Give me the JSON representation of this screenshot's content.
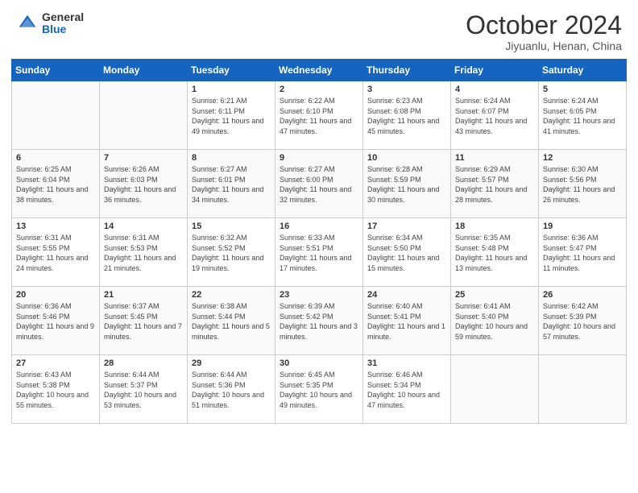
{
  "header": {
    "logo_general": "General",
    "logo_blue": "Blue",
    "month_title": "October 2024",
    "location": "Jiyuanlu, Henan, China"
  },
  "days_of_week": [
    "Sunday",
    "Monday",
    "Tuesday",
    "Wednesday",
    "Thursday",
    "Friday",
    "Saturday"
  ],
  "weeks": [
    [
      {
        "day": "",
        "sunrise": "",
        "sunset": "",
        "daylight": ""
      },
      {
        "day": "",
        "sunrise": "",
        "sunset": "",
        "daylight": ""
      },
      {
        "day": "1",
        "sunrise": "Sunrise: 6:21 AM",
        "sunset": "Sunset: 6:11 PM",
        "daylight": "Daylight: 11 hours and 49 minutes."
      },
      {
        "day": "2",
        "sunrise": "Sunrise: 6:22 AM",
        "sunset": "Sunset: 6:10 PM",
        "daylight": "Daylight: 11 hours and 47 minutes."
      },
      {
        "day": "3",
        "sunrise": "Sunrise: 6:23 AM",
        "sunset": "Sunset: 6:08 PM",
        "daylight": "Daylight: 11 hours and 45 minutes."
      },
      {
        "day": "4",
        "sunrise": "Sunrise: 6:24 AM",
        "sunset": "Sunset: 6:07 PM",
        "daylight": "Daylight: 11 hours and 43 minutes."
      },
      {
        "day": "5",
        "sunrise": "Sunrise: 6:24 AM",
        "sunset": "Sunset: 6:05 PM",
        "daylight": "Daylight: 11 hours and 41 minutes."
      }
    ],
    [
      {
        "day": "6",
        "sunrise": "Sunrise: 6:25 AM",
        "sunset": "Sunset: 6:04 PM",
        "daylight": "Daylight: 11 hours and 38 minutes."
      },
      {
        "day": "7",
        "sunrise": "Sunrise: 6:26 AM",
        "sunset": "Sunset: 6:03 PM",
        "daylight": "Daylight: 11 hours and 36 minutes."
      },
      {
        "day": "8",
        "sunrise": "Sunrise: 6:27 AM",
        "sunset": "Sunset: 6:01 PM",
        "daylight": "Daylight: 11 hours and 34 minutes."
      },
      {
        "day": "9",
        "sunrise": "Sunrise: 6:27 AM",
        "sunset": "Sunset: 6:00 PM",
        "daylight": "Daylight: 11 hours and 32 minutes."
      },
      {
        "day": "10",
        "sunrise": "Sunrise: 6:28 AM",
        "sunset": "Sunset: 5:59 PM",
        "daylight": "Daylight: 11 hours and 30 minutes."
      },
      {
        "day": "11",
        "sunrise": "Sunrise: 6:29 AM",
        "sunset": "Sunset: 5:57 PM",
        "daylight": "Daylight: 11 hours and 28 minutes."
      },
      {
        "day": "12",
        "sunrise": "Sunrise: 6:30 AM",
        "sunset": "Sunset: 5:56 PM",
        "daylight": "Daylight: 11 hours and 26 minutes."
      }
    ],
    [
      {
        "day": "13",
        "sunrise": "Sunrise: 6:31 AM",
        "sunset": "Sunset: 5:55 PM",
        "daylight": "Daylight: 11 hours and 24 minutes."
      },
      {
        "day": "14",
        "sunrise": "Sunrise: 6:31 AM",
        "sunset": "Sunset: 5:53 PM",
        "daylight": "Daylight: 11 hours and 21 minutes."
      },
      {
        "day": "15",
        "sunrise": "Sunrise: 6:32 AM",
        "sunset": "Sunset: 5:52 PM",
        "daylight": "Daylight: 11 hours and 19 minutes."
      },
      {
        "day": "16",
        "sunrise": "Sunrise: 6:33 AM",
        "sunset": "Sunset: 5:51 PM",
        "daylight": "Daylight: 11 hours and 17 minutes."
      },
      {
        "day": "17",
        "sunrise": "Sunrise: 6:34 AM",
        "sunset": "Sunset: 5:50 PM",
        "daylight": "Daylight: 11 hours and 15 minutes."
      },
      {
        "day": "18",
        "sunrise": "Sunrise: 6:35 AM",
        "sunset": "Sunset: 5:48 PM",
        "daylight": "Daylight: 11 hours and 13 minutes."
      },
      {
        "day": "19",
        "sunrise": "Sunrise: 6:36 AM",
        "sunset": "Sunset: 5:47 PM",
        "daylight": "Daylight: 11 hours and 11 minutes."
      }
    ],
    [
      {
        "day": "20",
        "sunrise": "Sunrise: 6:36 AM",
        "sunset": "Sunset: 5:46 PM",
        "daylight": "Daylight: 11 hours and 9 minutes."
      },
      {
        "day": "21",
        "sunrise": "Sunrise: 6:37 AM",
        "sunset": "Sunset: 5:45 PM",
        "daylight": "Daylight: 11 hours and 7 minutes."
      },
      {
        "day": "22",
        "sunrise": "Sunrise: 6:38 AM",
        "sunset": "Sunset: 5:44 PM",
        "daylight": "Daylight: 11 hours and 5 minutes."
      },
      {
        "day": "23",
        "sunrise": "Sunrise: 6:39 AM",
        "sunset": "Sunset: 5:42 PM",
        "daylight": "Daylight: 11 hours and 3 minutes."
      },
      {
        "day": "24",
        "sunrise": "Sunrise: 6:40 AM",
        "sunset": "Sunset: 5:41 PM",
        "daylight": "Daylight: 11 hours and 1 minute."
      },
      {
        "day": "25",
        "sunrise": "Sunrise: 6:41 AM",
        "sunset": "Sunset: 5:40 PM",
        "daylight": "Daylight: 10 hours and 59 minutes."
      },
      {
        "day": "26",
        "sunrise": "Sunrise: 6:42 AM",
        "sunset": "Sunset: 5:39 PM",
        "daylight": "Daylight: 10 hours and 57 minutes."
      }
    ],
    [
      {
        "day": "27",
        "sunrise": "Sunrise: 6:43 AM",
        "sunset": "Sunset: 5:38 PM",
        "daylight": "Daylight: 10 hours and 55 minutes."
      },
      {
        "day": "28",
        "sunrise": "Sunrise: 6:44 AM",
        "sunset": "Sunset: 5:37 PM",
        "daylight": "Daylight: 10 hours and 53 minutes."
      },
      {
        "day": "29",
        "sunrise": "Sunrise: 6:44 AM",
        "sunset": "Sunset: 5:36 PM",
        "daylight": "Daylight: 10 hours and 51 minutes."
      },
      {
        "day": "30",
        "sunrise": "Sunrise: 6:45 AM",
        "sunset": "Sunset: 5:35 PM",
        "daylight": "Daylight: 10 hours and 49 minutes."
      },
      {
        "day": "31",
        "sunrise": "Sunrise: 6:46 AM",
        "sunset": "Sunset: 5:34 PM",
        "daylight": "Daylight: 10 hours and 47 minutes."
      },
      {
        "day": "",
        "sunrise": "",
        "sunset": "",
        "daylight": ""
      },
      {
        "day": "",
        "sunrise": "",
        "sunset": "",
        "daylight": ""
      }
    ]
  ]
}
